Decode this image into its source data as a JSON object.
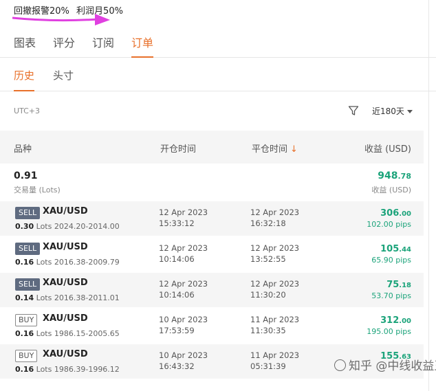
{
  "notice": {
    "drawdown": "回撤报警20%",
    "profit_target": "利润月50%"
  },
  "colors": {
    "accent": "#e8702a",
    "profit": "#1ba37a",
    "sell_badge": "#5f6b80",
    "annotation_arrow": "#e040e0"
  },
  "tabs": [
    {
      "label": "图表"
    },
    {
      "label": "评分"
    },
    {
      "label": "订阅"
    },
    {
      "label": "订单",
      "active": true
    }
  ],
  "subtabs": [
    {
      "label": "历史",
      "active": true
    },
    {
      "label": "头寸"
    }
  ],
  "toolbar": {
    "timezone": "UTC+3",
    "filter_icon": "filter-icon",
    "period": "近180天"
  },
  "columns": {
    "instrument": "品种",
    "open_time": "开仓时间",
    "close_time": "平仓时间",
    "sort_indicator": "↓",
    "profit": "收益 (USD)"
  },
  "summary": {
    "lots": "0.91",
    "lots_label": "交易量 (Lots)",
    "profit_int": "948",
    "profit_dec": ".78",
    "profit_label": "收益 (USD)"
  },
  "orders": [
    {
      "type": "SELL",
      "symbol": "XAU/USD",
      "lots": "0.30",
      "lots_unit": "Lots",
      "price_range": "2024.20-2014.00",
      "open_date": "12 Apr 2023",
      "open_time": "15:33:12",
      "close_date": "12 Apr 2023",
      "close_time": "16:32:18",
      "profit_int": "306",
      "profit_dec": ".00",
      "pips": "102.00 pips"
    },
    {
      "type": "SELL",
      "symbol": "XAU/USD",
      "lots": "0.16",
      "lots_unit": "Lots",
      "price_range": "2016.38-2009.79",
      "open_date": "12 Apr 2023",
      "open_time": "10:14:06",
      "close_date": "12 Apr 2023",
      "close_time": "13:52:55",
      "profit_int": "105",
      "profit_dec": ".44",
      "pips": "65.90 pips"
    },
    {
      "type": "SELL",
      "symbol": "XAU/USD",
      "lots": "0.14",
      "lots_unit": "Lots",
      "price_range": "2016.38-2011.01",
      "open_date": "12 Apr 2023",
      "open_time": "10:14:06",
      "close_date": "12 Apr 2023",
      "close_time": "11:30:20",
      "profit_int": "75",
      "profit_dec": ".18",
      "pips": "53.70 pips"
    },
    {
      "type": "BUY",
      "symbol": "XAU/USD",
      "lots": "0.16",
      "lots_unit": "Lots",
      "price_range": "1986.15-2005.65",
      "open_date": "10 Apr 2023",
      "open_time": "17:53:59",
      "close_date": "11 Apr 2023",
      "close_time": "11:30:35",
      "profit_int": "312",
      "profit_dec": ".00",
      "pips": "195.00 pips"
    },
    {
      "type": "BUY",
      "symbol": "XAU/USD",
      "lots": "0.16",
      "lots_unit": "Lots",
      "price_range": "1986.39-1996.12",
      "open_date": "10 Apr 2023",
      "open_time": "16:43:32",
      "close_date": "11 Apr 2023",
      "close_time": "05:31:39",
      "profit_int": "155",
      "profit_dec": ".63",
      "pips": ""
    }
  ],
  "watermark": "知乎 @中线收益王"
}
